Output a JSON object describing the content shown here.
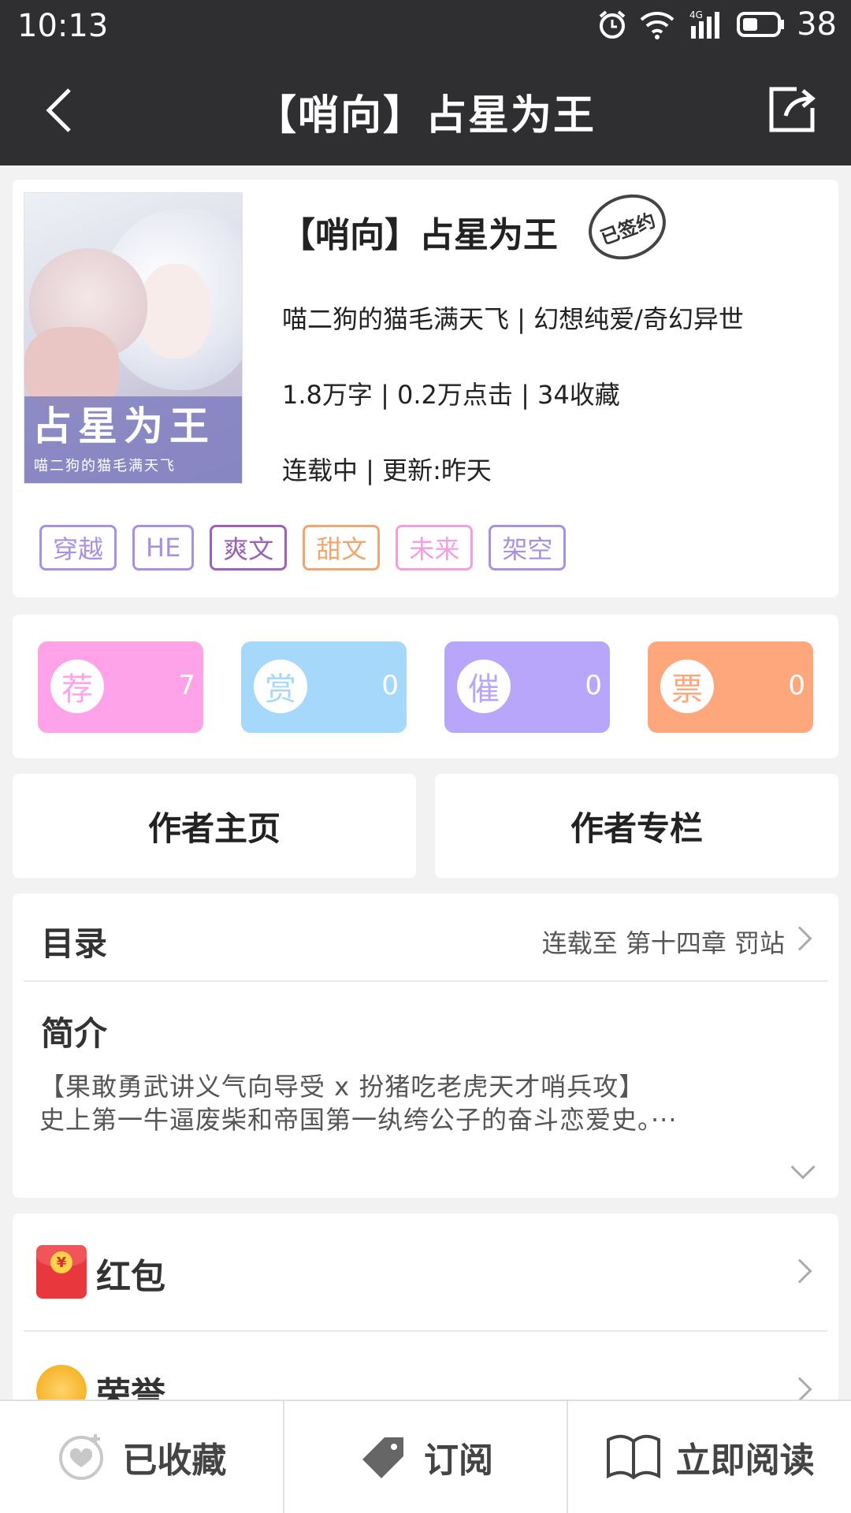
{
  "status_bar": {
    "time": "10:13",
    "battery": "38",
    "network": "4G"
  },
  "nav": {
    "title": "【哨向】占星为王"
  },
  "book": {
    "title": "【哨向】占星为王",
    "stamp": "已签约",
    "cover_title": "占星为王",
    "cover_author": "喵二狗的猫毛满天飞",
    "meta_line": "喵二狗的猫毛满天飞 | 幻想纯爱/奇幻异世",
    "stats_line": "1.8万字 | 0.2万点击 | 34收藏",
    "status_line": "连载中 | 更新:昨天",
    "tags": [
      {
        "label": "穿越",
        "color": "#a990e0"
      },
      {
        "label": "HE",
        "color": "#a990e0"
      },
      {
        "label": "爽文",
        "color": "#9a62b8"
      },
      {
        "label": "甜文",
        "color": "#f3a56e"
      },
      {
        "label": "未来",
        "color": "#f29ee0"
      },
      {
        "label": "架空",
        "color": "#a990e0"
      }
    ]
  },
  "stats": [
    {
      "label": "荐",
      "value": "7",
      "color": "#fea2e9"
    },
    {
      "label": "赏",
      "value": "0",
      "color": "#a6d8fb"
    },
    {
      "label": "催",
      "value": "0",
      "color": "#b8a6fb"
    },
    {
      "label": "票",
      "value": "0",
      "color": "#fea67c"
    }
  ],
  "author_buttons": {
    "home": "作者主页",
    "column": "作者专栏"
  },
  "toc": {
    "label": "目录",
    "latest": "连载至 第十四章 罚站"
  },
  "intro": {
    "label": "简介",
    "line1": "【果敢勇武讲义气向导受 x 扮猪吃老虎天才哨兵攻】",
    "line2": "史上第一牛逼废柴和帝国第一纨绔公子的奋斗恋爱史。···"
  },
  "misc": {
    "red_packet": "红包",
    "honor": "荣誉",
    "yen": "¥"
  },
  "bottom": {
    "collected": "已收藏",
    "subscribe": "订阅",
    "read": "立即阅读"
  }
}
